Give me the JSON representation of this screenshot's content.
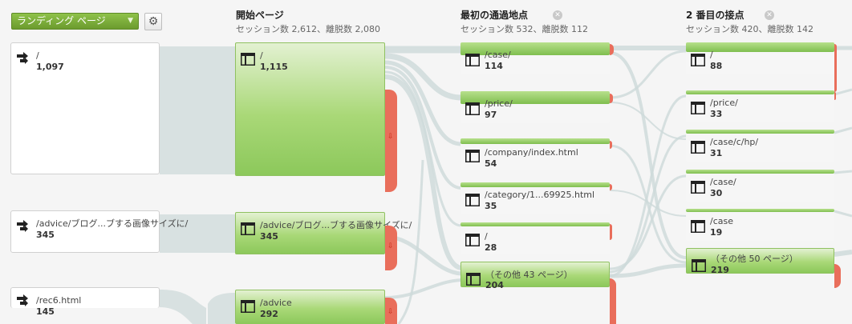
{
  "toolbar": {
    "dimension_select": "ランディング ページ",
    "settings_icon": "gear-icon"
  },
  "columns": [
    {
      "title": "開始ページ",
      "stats": "セッション数 2,612、離脱数 2,080",
      "closable": false
    },
    {
      "title": "最初の通過地点",
      "stats": "セッション数 532、離脱数 112",
      "closable": true
    },
    {
      "title": "2 番目の接点",
      "stats": "セッション数 420、離脱数 142",
      "closable": true
    }
  ],
  "sources": [
    {
      "label": "/",
      "value": "1,097"
    },
    {
      "label": "/advice/ブログ...ブする画像サイズに/",
      "value": "345"
    },
    {
      "label": "/rec6.html",
      "value": "145"
    }
  ],
  "start_pages": [
    {
      "label": "/",
      "value": "1,115"
    },
    {
      "label": "/advice/ブログ...ブする画像サイズに/",
      "value": "345"
    },
    {
      "label": "/advice",
      "value": "292"
    }
  ],
  "first_interaction": [
    {
      "label": "/case/",
      "value": "114"
    },
    {
      "label": "/price/",
      "value": "97"
    },
    {
      "label": "/company/index.html",
      "value": "54"
    },
    {
      "label": "/category/1...69925.html",
      "value": "35"
    },
    {
      "label": "/",
      "value": "28"
    },
    {
      "label": "（その他 43 ページ）",
      "value": "204"
    }
  ],
  "second_interaction": [
    {
      "label": "/",
      "value": "88"
    },
    {
      "label": "/price/",
      "value": "33"
    },
    {
      "label": "/case/c/hp/",
      "value": "31"
    },
    {
      "label": "/case/",
      "value": "30"
    },
    {
      "label": "/case",
      "value": "19"
    },
    {
      "label": "（その他 50 ページ）",
      "value": "219"
    }
  ],
  "colors": {
    "node_green": "#8cc85b",
    "dropoff_red": "#e96e5b",
    "flow_gray": "#c9d7d7",
    "dropdown_green": "#7aab3a"
  }
}
